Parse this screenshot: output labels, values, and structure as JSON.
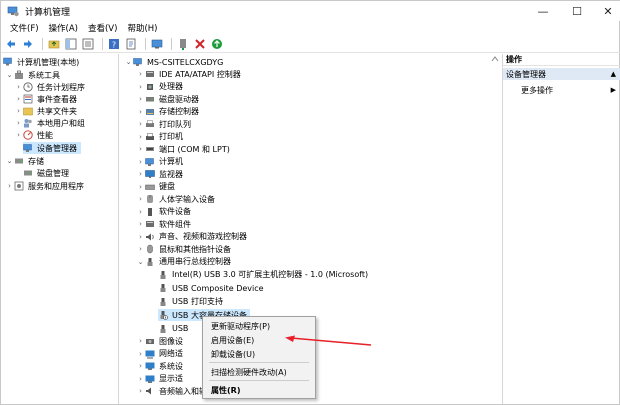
{
  "window": {
    "title": "计算机管理",
    "minimize": "—",
    "maximize": "☐",
    "close": "✕"
  },
  "menu": [
    "文件(F)",
    "操作(A)",
    "查看(V)",
    "帮助(H)"
  ],
  "toolbar_icons": [
    "back-icon",
    "forward-icon",
    "up-folder-icon",
    "show-tree-icon",
    "list-icon",
    "help-icon",
    "properties-icon",
    "monitor-icon",
    "add-driver-icon",
    "delete-icon",
    "refresh-icon"
  ],
  "left_tree": {
    "root": "计算机管理(本地)",
    "system_tools": "系统工具",
    "task_scheduler": "任务计划程序",
    "event_viewer": "事件查看器",
    "shared_folders": "共享文件夹",
    "local_users": "本地用户和组",
    "performance": "性能",
    "device_manager": "设备管理器",
    "storage": "存储",
    "disk_management": "磁盘管理",
    "services": "服务和应用程序"
  },
  "device_tree": {
    "computer": "MS-CSITELCXGDYG",
    "categories": [
      "IDE ATA/ATAPI 控制器",
      "处理器",
      "磁盘驱动器",
      "存储控制器",
      "打印队列",
      "打印机",
      "端口 (COM 和 LPT)",
      "计算机",
      "监视器",
      "键盘",
      "人体学输入设备",
      "软件设备",
      "软件组件",
      "声音、视频和游戏控制器",
      "鼠标和其他指针设备",
      "通用串行总线控制器"
    ],
    "usb_children": [
      "Intel(R) USB 3.0 可扩展主机控制器 - 1.0 (Microsoft)",
      "USB Composite Device",
      "USB 打印支持",
      "USB 大容量存储设备",
      "USB"
    ],
    "after": [
      "图像设",
      "网络适",
      "系统设",
      "显示适",
      "音频输入和输出"
    ]
  },
  "actions": {
    "header": "操作",
    "section": "设备管理器",
    "more": "更多操作"
  },
  "context_menu": {
    "update_driver": "更新驱动程序(P)",
    "enable_device": "启用设备(E)",
    "uninstall_device": "卸载设备(U)",
    "scan_changes": "扫描检测硬件改动(A)",
    "properties": "属性(R)"
  },
  "colors": {
    "selection": "#cce8ff",
    "action_section": "#dfe8f5",
    "arrow": "#e8202a"
  }
}
